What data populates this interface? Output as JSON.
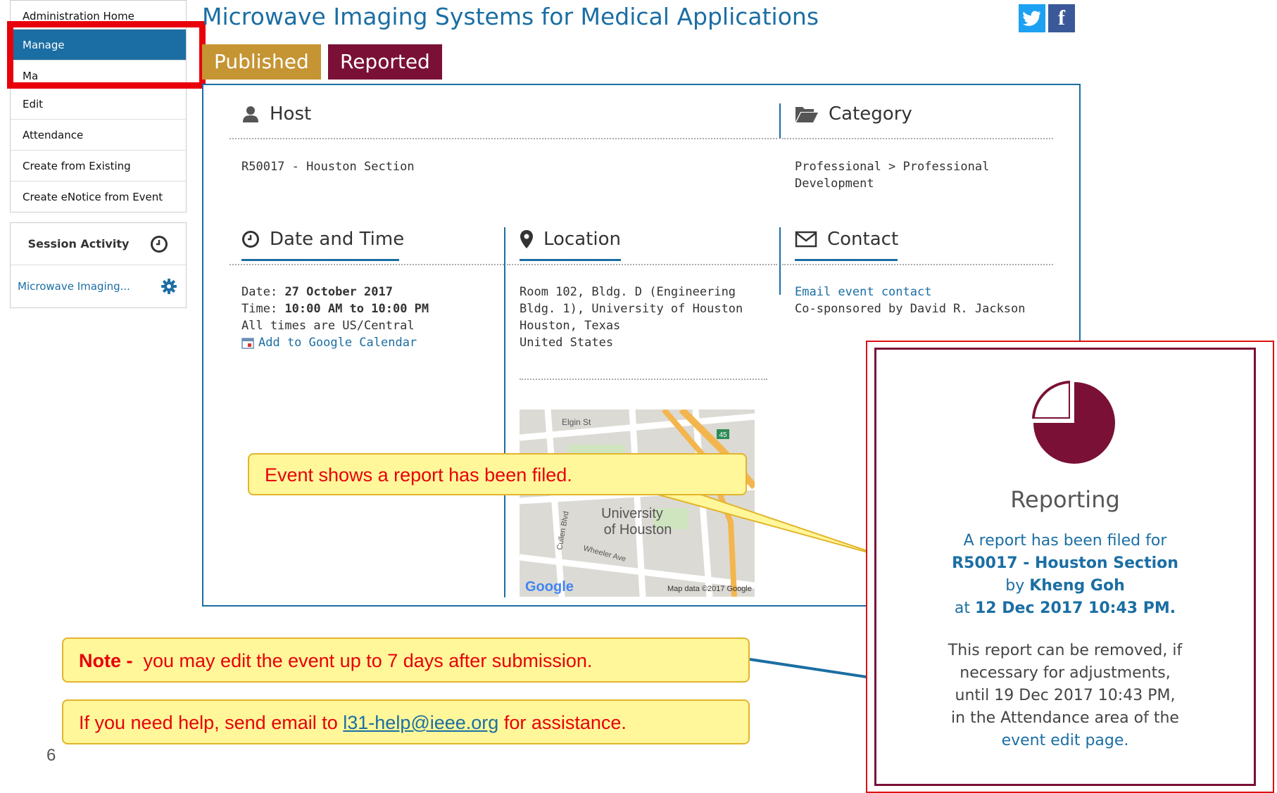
{
  "sidebar": {
    "menu": [
      {
        "label": "Administration Home"
      },
      {
        "label": "Manage"
      },
      {
        "label": "Ma"
      },
      {
        "label": "Edit"
      },
      {
        "label": "Attendance"
      },
      {
        "label": "Create from Existing"
      },
      {
        "label": "Create eNotice from Event"
      }
    ],
    "session_activity_label": "Session Activity",
    "session_item_label": "Microwave Imaging..."
  },
  "header": {
    "title": "Microwave Imaging Systems for Medical Applications",
    "badges": {
      "published": "Published",
      "reported": "Reported"
    },
    "social": {
      "twitter": "t",
      "facebook": "f"
    }
  },
  "host": {
    "heading": "Host",
    "value": "R50017 - Houston Section"
  },
  "category": {
    "heading": "Category",
    "line1": "Professional > Professional",
    "line2": "Development"
  },
  "datetime": {
    "heading": "Date and Time",
    "date_label": "Date:",
    "date_value": "27 October 2017",
    "time_label": "Time:",
    "time_value": "10:00 AM to 10:00 PM",
    "tz": "All times are US/Central",
    "calendar_link": "Add to Google Calendar"
  },
  "location": {
    "heading": "Location",
    "lines": [
      "Room 102, Bldg. D (Engineering",
      "Bldg. 1), University of Houston",
      "Houston, Texas",
      "United States"
    ],
    "map": {
      "street1": "Elgin St",
      "street2": "Cullen Blvd",
      "street3": "Wheeler Ave",
      "campus_line1": "University",
      "campus_line2": "of Houston",
      "route": "45",
      "logo": "Google",
      "credit": "Map data ©2017 Google"
    }
  },
  "contact": {
    "heading": "Contact",
    "email_link": "Email event contact",
    "cosponsor": "Co-sponsored by David R. Jackson"
  },
  "callouts": {
    "report_filed": "Event shows a report has been filed.",
    "note_bold": "Note -",
    "note_text": "you may edit the event up to 7 days after submission.",
    "help_prefix": "If you need help, send email to",
    "help_email": "l31-help@ieee.org",
    "help_suffix": "for assistance."
  },
  "slide_number": "6",
  "reporting": {
    "title": "Reporting",
    "line1": "A report has been filed for",
    "section": "R50017 - Houston Section",
    "by_label": "by",
    "reporter": "Kheng Goh",
    "at_label": "at",
    "timestamp": "12 Dec 2017 10:43 PM.",
    "note_lines": [
      "This report can be removed, if",
      "necessary for adjustments,",
      "until 19 Dec 2017 10:43 PM,",
      "in the Attendance area of the"
    ],
    "edit_link": "event edit page."
  },
  "colors": {
    "accent_blue": "#1b6ea3",
    "published": "#c59433",
    "reported": "#7a1035",
    "highlight_red": "#e8000b",
    "callout_fill": "#fff79a"
  }
}
